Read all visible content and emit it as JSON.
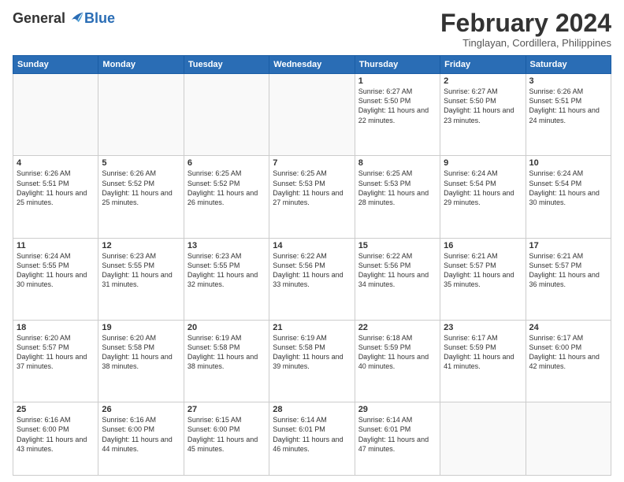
{
  "header": {
    "logo_general": "General",
    "logo_blue": "Blue",
    "month_title": "February 2024",
    "location": "Tinglayan, Cordillera, Philippines"
  },
  "days_of_week": [
    "Sunday",
    "Monday",
    "Tuesday",
    "Wednesday",
    "Thursday",
    "Friday",
    "Saturday"
  ],
  "weeks": [
    [
      {
        "day": "",
        "info": ""
      },
      {
        "day": "",
        "info": ""
      },
      {
        "day": "",
        "info": ""
      },
      {
        "day": "",
        "info": ""
      },
      {
        "day": "1",
        "info": "Sunrise: 6:27 AM\nSunset: 5:50 PM\nDaylight: 11 hours and 22 minutes."
      },
      {
        "day": "2",
        "info": "Sunrise: 6:27 AM\nSunset: 5:50 PM\nDaylight: 11 hours and 23 minutes."
      },
      {
        "day": "3",
        "info": "Sunrise: 6:26 AM\nSunset: 5:51 PM\nDaylight: 11 hours and 24 minutes."
      }
    ],
    [
      {
        "day": "4",
        "info": "Sunrise: 6:26 AM\nSunset: 5:51 PM\nDaylight: 11 hours and 25 minutes."
      },
      {
        "day": "5",
        "info": "Sunrise: 6:26 AM\nSunset: 5:52 PM\nDaylight: 11 hours and 25 minutes."
      },
      {
        "day": "6",
        "info": "Sunrise: 6:25 AM\nSunset: 5:52 PM\nDaylight: 11 hours and 26 minutes."
      },
      {
        "day": "7",
        "info": "Sunrise: 6:25 AM\nSunset: 5:53 PM\nDaylight: 11 hours and 27 minutes."
      },
      {
        "day": "8",
        "info": "Sunrise: 6:25 AM\nSunset: 5:53 PM\nDaylight: 11 hours and 28 minutes."
      },
      {
        "day": "9",
        "info": "Sunrise: 6:24 AM\nSunset: 5:54 PM\nDaylight: 11 hours and 29 minutes."
      },
      {
        "day": "10",
        "info": "Sunrise: 6:24 AM\nSunset: 5:54 PM\nDaylight: 11 hours and 30 minutes."
      }
    ],
    [
      {
        "day": "11",
        "info": "Sunrise: 6:24 AM\nSunset: 5:55 PM\nDaylight: 11 hours and 30 minutes."
      },
      {
        "day": "12",
        "info": "Sunrise: 6:23 AM\nSunset: 5:55 PM\nDaylight: 11 hours and 31 minutes."
      },
      {
        "day": "13",
        "info": "Sunrise: 6:23 AM\nSunset: 5:55 PM\nDaylight: 11 hours and 32 minutes."
      },
      {
        "day": "14",
        "info": "Sunrise: 6:22 AM\nSunset: 5:56 PM\nDaylight: 11 hours and 33 minutes."
      },
      {
        "day": "15",
        "info": "Sunrise: 6:22 AM\nSunset: 5:56 PM\nDaylight: 11 hours and 34 minutes."
      },
      {
        "day": "16",
        "info": "Sunrise: 6:21 AM\nSunset: 5:57 PM\nDaylight: 11 hours and 35 minutes."
      },
      {
        "day": "17",
        "info": "Sunrise: 6:21 AM\nSunset: 5:57 PM\nDaylight: 11 hours and 36 minutes."
      }
    ],
    [
      {
        "day": "18",
        "info": "Sunrise: 6:20 AM\nSunset: 5:57 PM\nDaylight: 11 hours and 37 minutes."
      },
      {
        "day": "19",
        "info": "Sunrise: 6:20 AM\nSunset: 5:58 PM\nDaylight: 11 hours and 38 minutes."
      },
      {
        "day": "20",
        "info": "Sunrise: 6:19 AM\nSunset: 5:58 PM\nDaylight: 11 hours and 38 minutes."
      },
      {
        "day": "21",
        "info": "Sunrise: 6:19 AM\nSunset: 5:58 PM\nDaylight: 11 hours and 39 minutes."
      },
      {
        "day": "22",
        "info": "Sunrise: 6:18 AM\nSunset: 5:59 PM\nDaylight: 11 hours and 40 minutes."
      },
      {
        "day": "23",
        "info": "Sunrise: 6:17 AM\nSunset: 5:59 PM\nDaylight: 11 hours and 41 minutes."
      },
      {
        "day": "24",
        "info": "Sunrise: 6:17 AM\nSunset: 6:00 PM\nDaylight: 11 hours and 42 minutes."
      }
    ],
    [
      {
        "day": "25",
        "info": "Sunrise: 6:16 AM\nSunset: 6:00 PM\nDaylight: 11 hours and 43 minutes."
      },
      {
        "day": "26",
        "info": "Sunrise: 6:16 AM\nSunset: 6:00 PM\nDaylight: 11 hours and 44 minutes."
      },
      {
        "day": "27",
        "info": "Sunrise: 6:15 AM\nSunset: 6:00 PM\nDaylight: 11 hours and 45 minutes."
      },
      {
        "day": "28",
        "info": "Sunrise: 6:14 AM\nSunset: 6:01 PM\nDaylight: 11 hours and 46 minutes."
      },
      {
        "day": "29",
        "info": "Sunrise: 6:14 AM\nSunset: 6:01 PM\nDaylight: 11 hours and 47 minutes."
      },
      {
        "day": "",
        "info": ""
      },
      {
        "day": "",
        "info": ""
      }
    ]
  ]
}
